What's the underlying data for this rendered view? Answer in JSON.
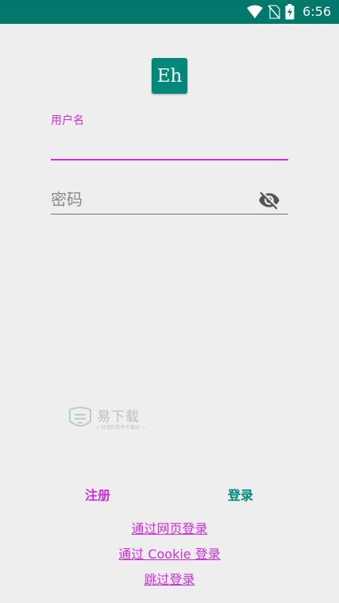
{
  "status_bar": {
    "time": "6:56",
    "icons": [
      "wifi-icon",
      "no-sim-icon",
      "battery-charging-icon"
    ],
    "color": "#00796b"
  },
  "app": {
    "logo_text": "Eh",
    "logo_color": "#00897b"
  },
  "login_form": {
    "username_label": "用户名",
    "username_value": "",
    "password_placeholder": "密码",
    "password_value": "",
    "visibility_icon": "visibility-off-icon",
    "accent_color": "#d02ee0"
  },
  "watermark": {
    "text": "易下载",
    "slogan": "— 好用的软件下载站 —"
  },
  "actions": {
    "register_label": "注册",
    "login_label": "登录"
  },
  "links": {
    "web_login": "通过网页登录",
    "cookie_login": "通过 Cookie 登录",
    "skip_login": "跳过登录"
  }
}
